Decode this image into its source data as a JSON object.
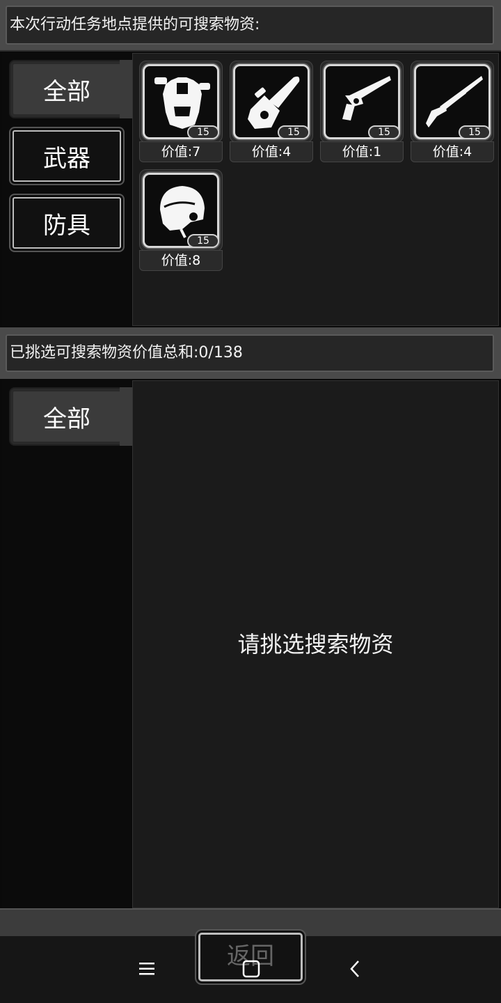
{
  "header": {
    "title": "本次行动任务地点提供的可搜索物资:"
  },
  "top_categories": [
    {
      "label": "全部",
      "active": true
    },
    {
      "label": "武器",
      "active": false
    },
    {
      "label": "防具",
      "active": false
    }
  ],
  "items": [
    {
      "icon": "body-armor-icon",
      "count": "15",
      "value": "价值:7"
    },
    {
      "icon": "chainsaw-icon",
      "count": "15",
      "value": "价值:4"
    },
    {
      "icon": "revolver-icon",
      "count": "15",
      "value": "价值:1"
    },
    {
      "icon": "shotgun-icon",
      "count": "15",
      "value": "价值:4"
    },
    {
      "icon": "helmet-icon",
      "count": "15",
      "value": "价值:8"
    }
  ],
  "summary": {
    "text": "已挑选可搜索物资价值总和:0/138"
  },
  "bottom_categories": [
    {
      "label": "全部",
      "active": true
    }
  ],
  "empty_message": "请挑选搜索物资",
  "return_button": {
    "label": "返回"
  },
  "system_nav": {
    "menu_icon": "menu-icon",
    "home_icon": "home-icon",
    "back_icon": "back-icon"
  }
}
